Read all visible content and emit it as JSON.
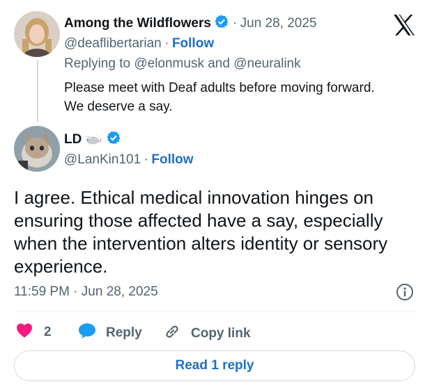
{
  "colors": {
    "accent": "#1d6fc4",
    "like": "#f91880",
    "muted": "#536471",
    "verified": "#1d9bf0"
  },
  "parent": {
    "display_name": "Among the Wildflowers",
    "separator": "·",
    "date": "Jun 28, 2025",
    "handle": "@deaflibertarian",
    "follow_label": "Follow",
    "replying_prefix": "Replying to",
    "replying_users": [
      "@elonmusk",
      "@neuralink"
    ],
    "replying_conj": "and",
    "text_line1": "Please meet with Deaf adults before moving forward.",
    "text_line2": "We deserve a say."
  },
  "reply": {
    "display_name": "LD",
    "handle": "@LanKin101",
    "follow_label": "Follow",
    "text": "I agree. Ethical medical innovation hinges on ensuring those affected have a say, especially when the intervention alters identity or sensory experience.",
    "timestamp": "11:59 PM · Jun 28, 2025"
  },
  "actions": {
    "like_count": "2",
    "reply_label": "Reply",
    "copy_link_label": "Copy link"
  },
  "read_replies_label": "Read 1 reply",
  "icons": [
    "x-logo-icon",
    "verified-icon",
    "mouse-emoji-icon",
    "info-icon",
    "heart-icon",
    "reply-bubble-icon",
    "link-icon"
  ]
}
